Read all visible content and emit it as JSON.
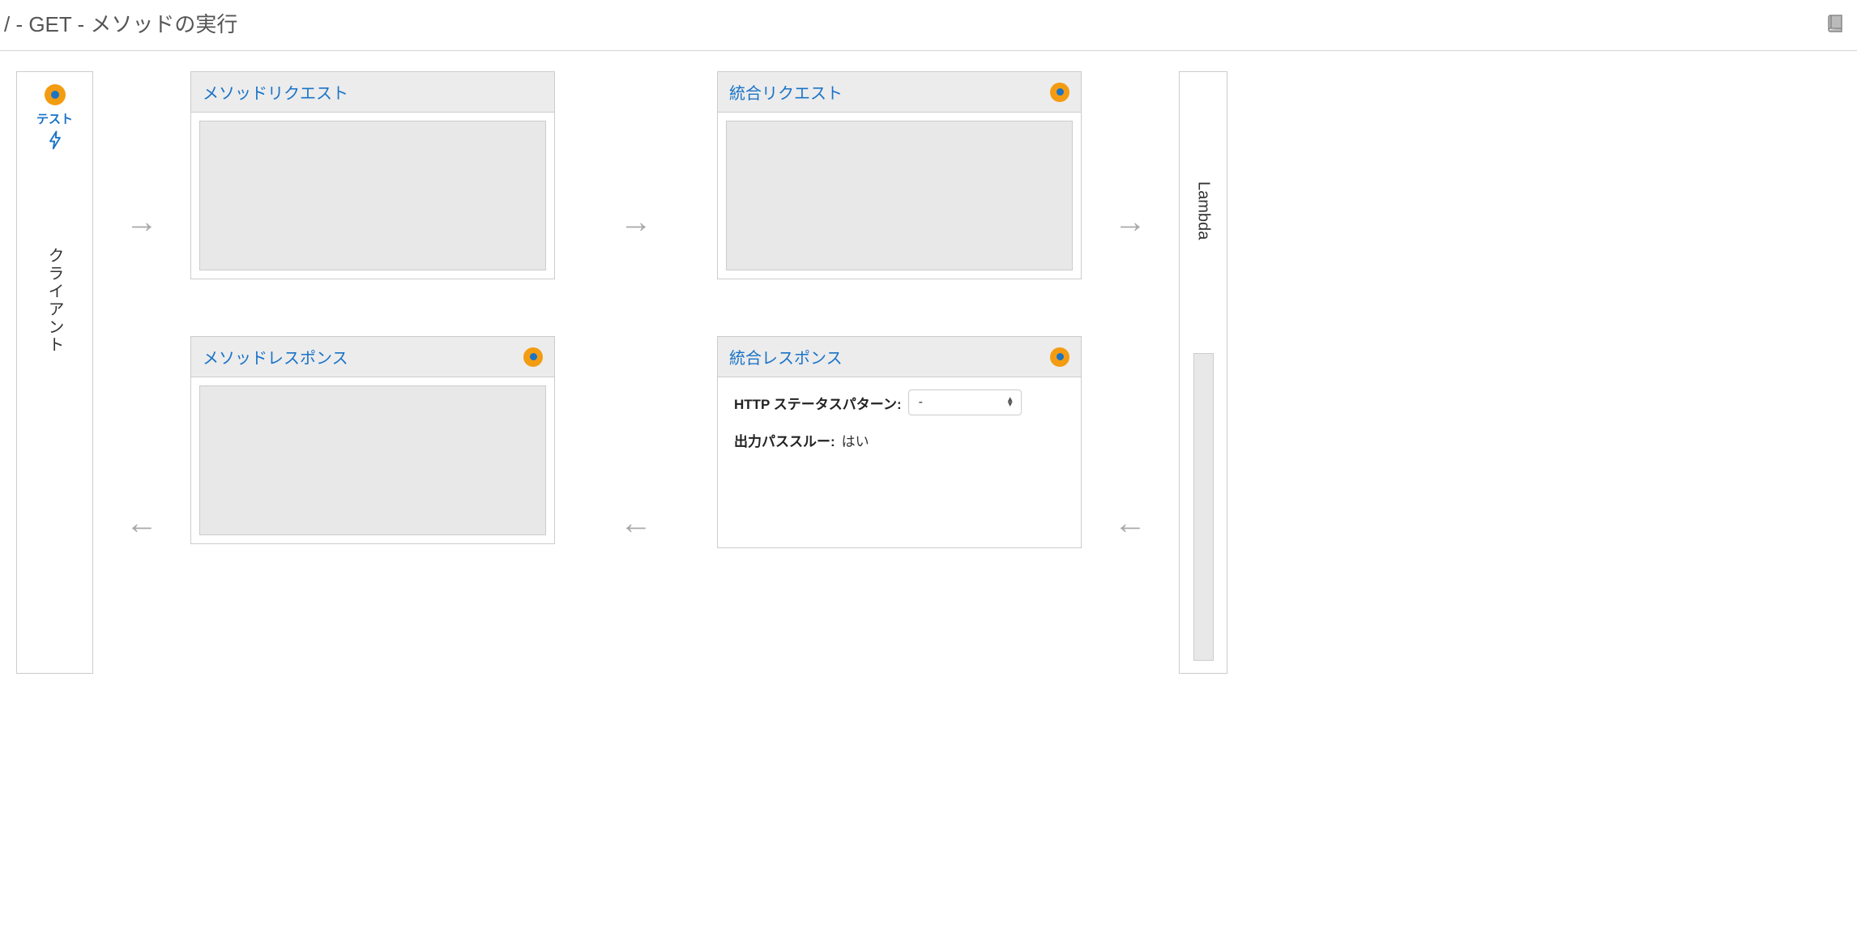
{
  "header": {
    "title": "/ - GET - メソッドの実行"
  },
  "client": {
    "test_label": "テスト",
    "label": "クライアント"
  },
  "lambda": {
    "label": "Lambda"
  },
  "panels": {
    "method_request": {
      "title": "メソッドリクエスト"
    },
    "integration_request": {
      "title": "統合リクエスト"
    },
    "method_response": {
      "title": "メソッドレスポンス"
    },
    "integration_response": {
      "title": "統合レスポンス",
      "http_status_label": "HTTP ステータスパターン:",
      "http_status_value": "-",
      "passthrough_label": "出力パススルー:",
      "passthrough_value": "はい"
    }
  }
}
